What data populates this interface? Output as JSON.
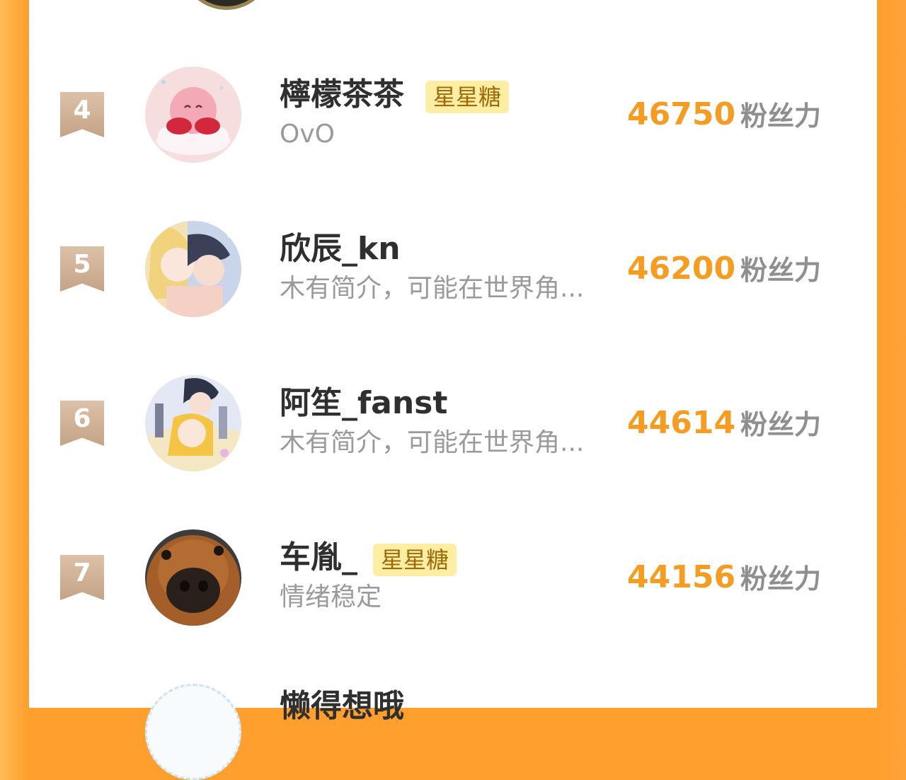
{
  "ranking": {
    "unit_label": "粉丝力",
    "rows": [
      {
        "rank": "4",
        "name": "檸檬茶茶",
        "tag": "星星糖",
        "bio": "OvO",
        "score": "46750",
        "avatar": "kirby-cloud-avatar"
      },
      {
        "rank": "5",
        "name": "欣辰_kn",
        "tag": "",
        "bio": "木有简介，可能在世界角...",
        "score": "46200",
        "avatar": "anime-couple-avatar"
      },
      {
        "rank": "6",
        "name": "阿笙_fanst",
        "tag": "",
        "bio": "木有简介，可能在世界角...",
        "score": "44614",
        "avatar": "anime-group-avatar"
      },
      {
        "rank": "7",
        "name": "车胤_",
        "tag": "星星糖",
        "bio": "情绪稳定",
        "score": "44156",
        "avatar": "dog-closeup-avatar"
      }
    ],
    "next_row_partial_name": "懒得想哦"
  },
  "colors": {
    "background": "#ff9f2e",
    "score": "#f59c22",
    "tag_bg": "#fdeea4",
    "tag_text": "#9e6a09",
    "rank_badge": "#c5a386"
  }
}
